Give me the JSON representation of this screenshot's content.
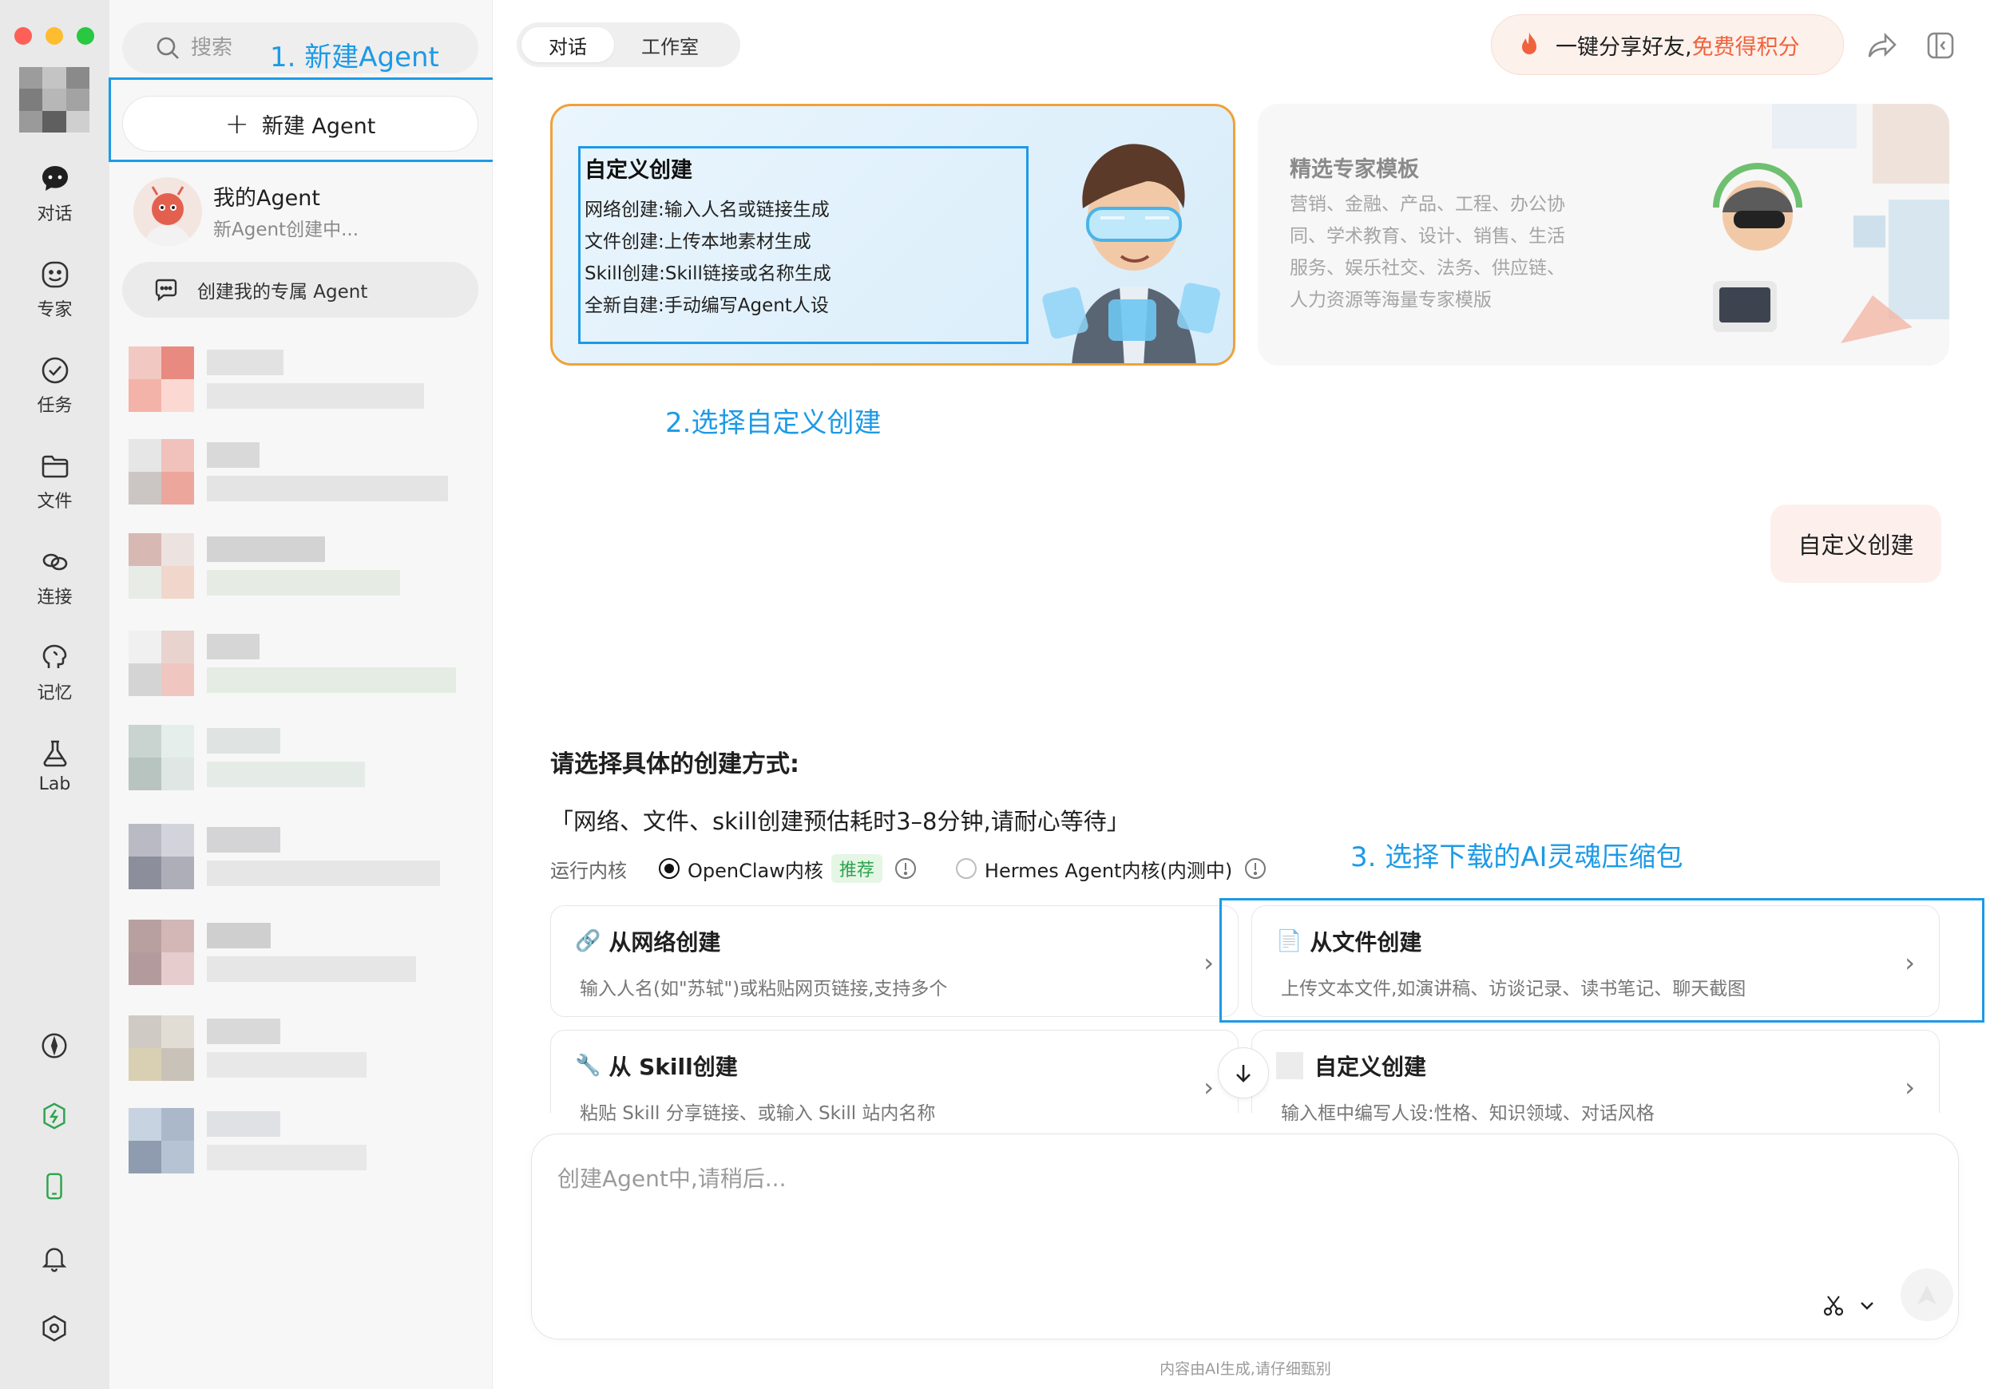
{
  "rail": {
    "items": [
      {
        "label": "对话",
        "icon": "chat-icon"
      },
      {
        "label": "专家",
        "icon": "smiley-icon"
      },
      {
        "label": "任务",
        "icon": "check-circle-icon"
      },
      {
        "label": "文件",
        "icon": "folder-icon"
      },
      {
        "label": "连接",
        "icon": "link-icon"
      },
      {
        "label": "记忆",
        "icon": "brain-icon"
      },
      {
        "label": "Lab",
        "icon": "flask-icon"
      }
    ],
    "bottom_icons": [
      "compass-icon",
      "wallet-icon",
      "phone-icon",
      "bell-icon",
      "settings-icon"
    ],
    "accent": "#2da44e"
  },
  "sidebar": {
    "search_placeholder": "搜索",
    "new_agent_label": "新建 Agent",
    "my_agent": {
      "name": "我的Agent",
      "status": "新Agent创建中..."
    },
    "create_own_label": "创建我的专属 Agent"
  },
  "header": {
    "tabs": [
      "对话",
      "工作室"
    ],
    "active_tab": "对话",
    "share_text": "一键分享好友,",
    "share_highlight": "免费得积分",
    "share_color": "#f0623c"
  },
  "cards": {
    "custom": {
      "title": "自定义创建",
      "lines": [
        "网络创建:输入人名或链接生成",
        "文件创建:上传本地素材生成",
        "Skill创建:Skill链接或名称生成",
        "全新自建:手动编写Agent人设"
      ],
      "border_color": "#f0a139"
    },
    "expert": {
      "title": "精选专家模板",
      "desc": "营销、金融、产品、工程、办公协同、学术教育、设计、销售、生活服务、娱乐社交、法务、供应链、人力资源等海量专家模版"
    }
  },
  "annotations": {
    "step1": "1. 新建Agent",
    "step2": "2.选择自定义创建",
    "step3": "3. 选择下载的AI灵魂压缩包",
    "color": "#1d9ae6"
  },
  "chat": {
    "user_message": "自定义创建",
    "prompt_title": "请选择具体的创建方式:",
    "prompt_note": "「网络、文件、skill创建预估耗时3–8分钟,请耐心等待」",
    "kernel_label": "运行内核",
    "kernel_options": [
      {
        "label": "OpenClaw内核",
        "badge": "推荐",
        "selected": true
      },
      {
        "label": "Hermes Agent内核(内测中)",
        "badge": "",
        "selected": false
      }
    ],
    "options": [
      {
        "title": "从网络创建",
        "glyph": "🔗",
        "desc": "输入人名(如\"苏轼\")或粘贴网页链接,支持多个"
      },
      {
        "title": "从文件创建",
        "glyph": "📄",
        "desc": "上传文本文件,如演讲稿、访谈记录、读书笔记、聊天截图"
      },
      {
        "title": "从 Skill创建",
        "glyph": "🔧",
        "desc": "粘贴 Skill 分享链接、或输入 Skill 站内名称"
      },
      {
        "title": "自定义创建",
        "glyph": "",
        "desc": "输入框中编写人设:性格、知识领域、对话风格"
      }
    ]
  },
  "composer": {
    "placeholder": "创建Agent中,请稍后...",
    "footer_note": "内容由AI生成,请仔细甄别"
  }
}
